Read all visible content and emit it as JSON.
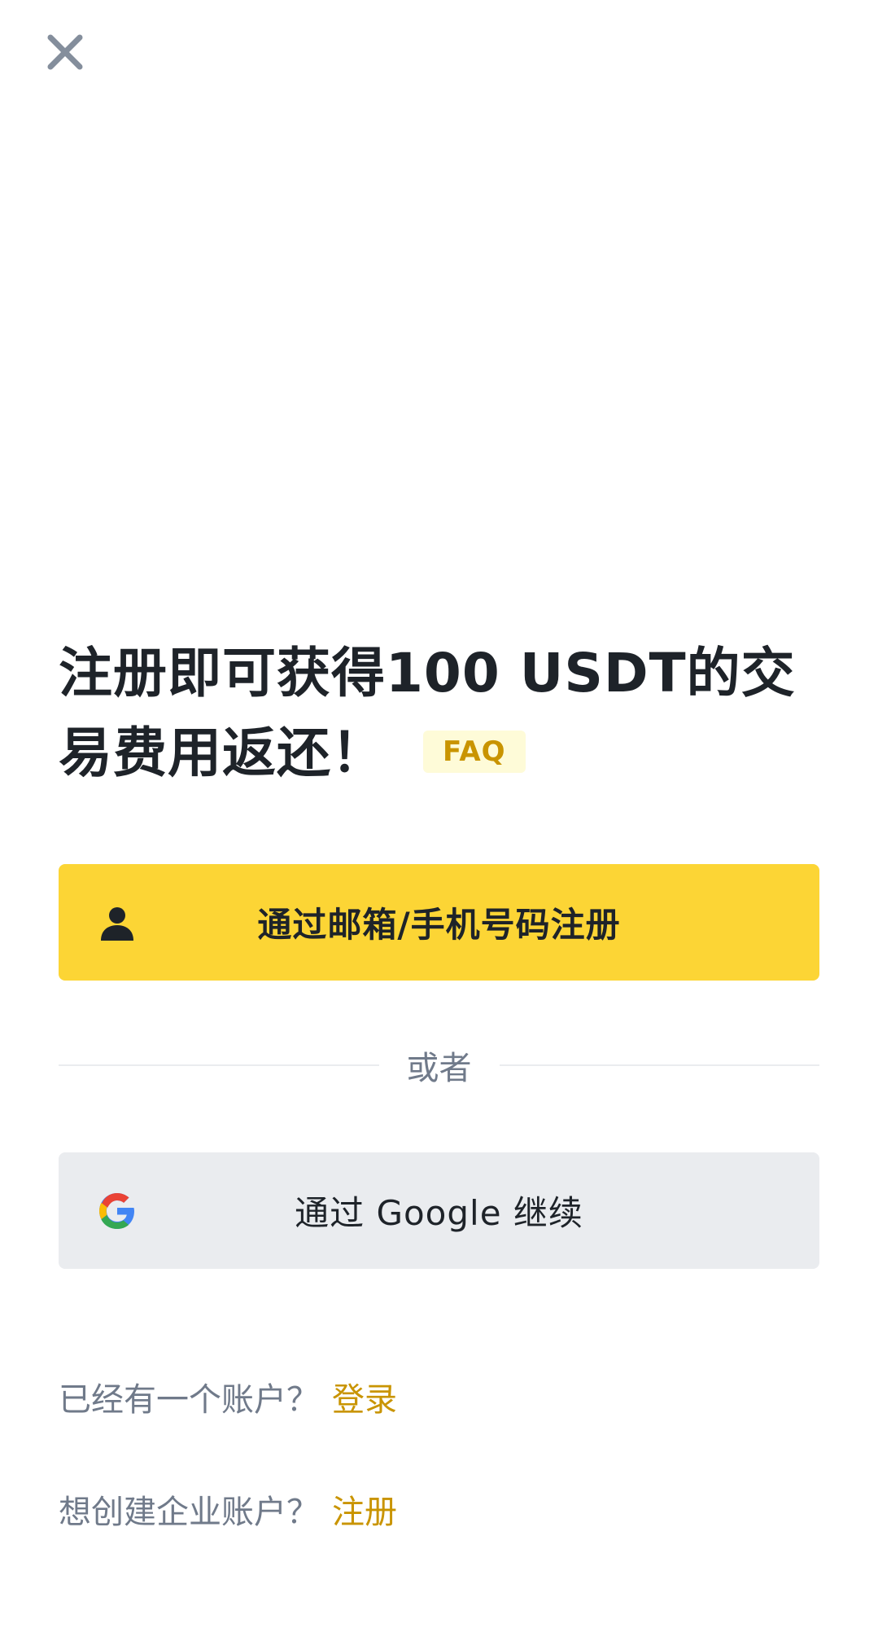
{
  "header": {
    "close_icon": "close-icon"
  },
  "headline": {
    "text": "注册即可获得100 USDT的交易费用返还！",
    "faq_label": "FAQ"
  },
  "primary_button": {
    "label": "通过邮箱/手机号码注册",
    "icon": "user-icon"
  },
  "divider": {
    "label": "或者"
  },
  "google_button": {
    "label": "通过 Google 继续",
    "icon": "google-icon"
  },
  "login_row": {
    "prompt": "已经有一个账户？",
    "link": "登录"
  },
  "business_row": {
    "prompt": "想创建企业账户？",
    "link": "注册"
  },
  "colors": {
    "accent_yellow": "#fcd535",
    "link_gold": "#c99400",
    "faq_bg": "#fefbd8",
    "secondary_bg": "#eaecef",
    "text_primary": "#1e2329",
    "text_secondary": "#707a8a"
  }
}
